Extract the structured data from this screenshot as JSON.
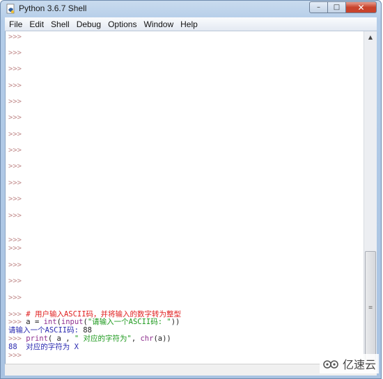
{
  "window": {
    "title": "Python 3.6.7 Shell",
    "icon": "python-idle-icon",
    "controls": {
      "minimize": "–",
      "maximize": "□",
      "close": "✕"
    }
  },
  "menubar": {
    "items": [
      "File",
      "Edit",
      "Shell",
      "Debug",
      "Options",
      "Window",
      "Help"
    ]
  },
  "shell": {
    "prompt": ">>>",
    "empty_prompt_count": 17,
    "code_lines": [
      {
        "prompt": ">>> ",
        "segments": [
          {
            "type": "comment",
            "text": "# 用户输入ASCII码，并将输入的数字转为整型"
          }
        ]
      },
      {
        "prompt": ">>> ",
        "segments": [
          {
            "type": "plain",
            "text": "a = "
          },
          {
            "type": "builtin",
            "text": "int"
          },
          {
            "type": "plain",
            "text": "("
          },
          {
            "type": "builtin",
            "text": "input"
          },
          {
            "type": "plain",
            "text": "("
          },
          {
            "type": "str",
            "text": "\"请输入一个ASCII码: \""
          },
          {
            "type": "plain",
            "text": "))"
          }
        ]
      },
      {
        "prompt": "",
        "segments": [
          {
            "type": "stdout",
            "text": "请输入一个ASCII码: "
          },
          {
            "type": "plain",
            "text": "88"
          }
        ]
      },
      {
        "prompt": ">>> ",
        "segments": [
          {
            "type": "builtin",
            "text": "print"
          },
          {
            "type": "plain",
            "text": "( a , "
          },
          {
            "type": "str",
            "text": "\" 对应的字符为\""
          },
          {
            "type": "plain",
            "text": ", "
          },
          {
            "type": "builtin",
            "text": "chr"
          },
          {
            "type": "plain",
            "text": "(a))"
          }
        ]
      },
      {
        "prompt": "",
        "segments": [
          {
            "type": "stdout",
            "text": "88  对应的字符为 X"
          }
        ]
      },
      {
        "prompt": ">>>",
        "segments": []
      }
    ]
  },
  "scrollbar": {
    "position_fraction": 1.0,
    "visible_fraction": 0.4
  },
  "watermark": {
    "text": "亿速云",
    "icon": "cloud-logo-icon"
  }
}
